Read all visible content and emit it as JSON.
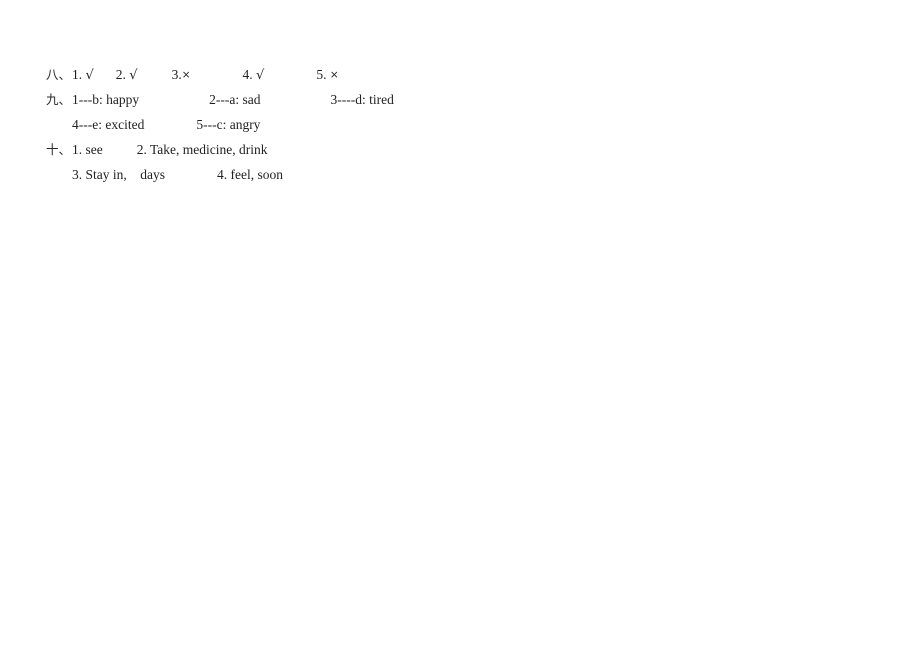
{
  "document": {
    "background_color": "#ffffff",
    "text_color": "#222222",
    "type": "answer-key"
  },
  "sections": [
    {
      "marker": "八、",
      "lines": [
        {
          "items": [
            {
              "number": "1.",
              "mark": "√"
            },
            {
              "number": "2.",
              "mark": "√"
            },
            {
              "number": "3.",
              "mark": "×"
            },
            {
              "number": "4.",
              "mark": "√"
            },
            {
              "number": "5.",
              "mark": "×"
            }
          ]
        }
      ]
    },
    {
      "marker": "九、",
      "lines": [
        {
          "items": [
            {
              "text": "1---b: happy"
            },
            {
              "text": "2---a: sad"
            },
            {
              "text": "3----d: tired"
            }
          ]
        },
        {
          "items": [
            {
              "text": "4---e: excited"
            },
            {
              "text": "5---c: angry"
            }
          ]
        }
      ]
    },
    {
      "marker": "十、",
      "lines": [
        {
          "items": [
            {
              "text": "1. see"
            },
            {
              "text": "2. Take, medicine, drink"
            }
          ]
        },
        {
          "items": [
            {
              "text": "3. Stay in,    days"
            },
            {
              "text": "4. feel, soon"
            }
          ]
        }
      ]
    }
  ]
}
